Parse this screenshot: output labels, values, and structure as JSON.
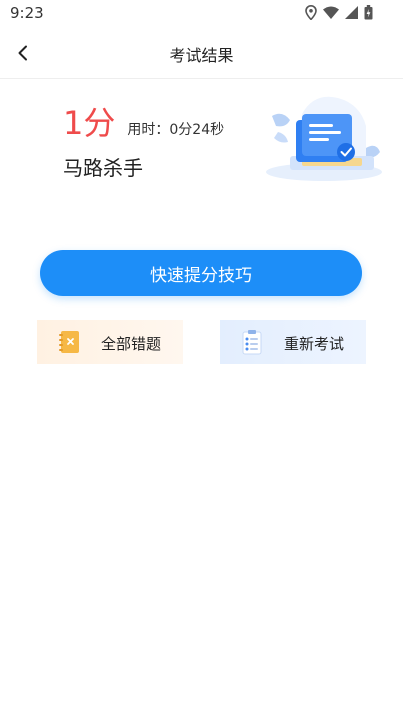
{
  "status_bar": {
    "time": "9:23",
    "icons": [
      "location-icon",
      "wifi-icon",
      "signal-icon",
      "battery-icon"
    ]
  },
  "header": {
    "title": "考试结果",
    "back_icon": "chevron-left-icon"
  },
  "result": {
    "score": "1分",
    "time_used": "用时：0分24秒",
    "rank_title": "马路杀手",
    "illustration": "exam-document-illustration"
  },
  "actions": {
    "primary_label": "快速提分技巧",
    "wrong_questions_label": "全部错题",
    "retake_label": "重新考试"
  },
  "colors": {
    "score": "#ef4b4b",
    "primary_button": "#1d8ef8",
    "wrong_card_bg": "#fff1e2",
    "retake_card_bg": "#e3eefe"
  }
}
